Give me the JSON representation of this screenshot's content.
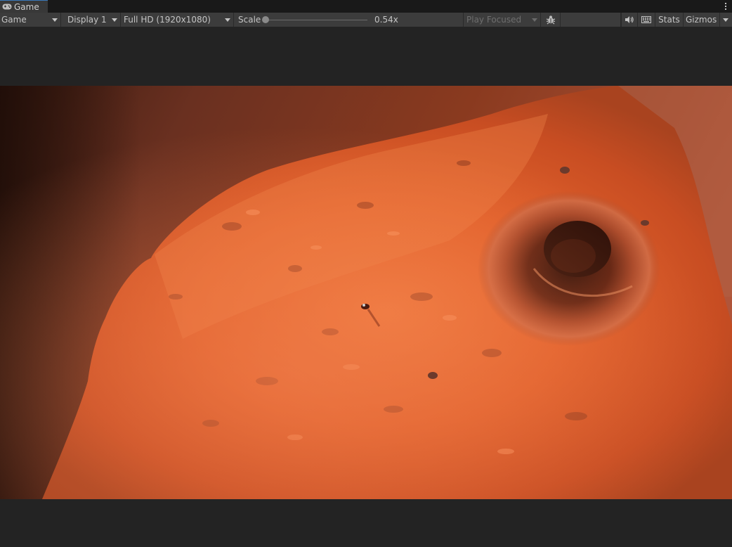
{
  "window": {
    "tab_title": "Game",
    "tab_icon": "gamepad-icon",
    "menu_icon": "kebab-menu-icon"
  },
  "toolbar": {
    "view_mode": "Game",
    "display": "Display 1",
    "resolution": "Full HD (1920x1080)",
    "scale_label": "Scale",
    "scale_value": "0.54x",
    "play_mode": "Play Focused",
    "bug_icon": "bug-icon",
    "mute_icon": "speaker-icon",
    "keyboard_icon": "keyboard-icon",
    "stats_label": "Stats",
    "gizmos_label": "Gizmos"
  },
  "colors": {
    "editor_bg": "#232323",
    "toolbar_bg": "#3c3c3c",
    "tab_accent": "#3a79bb",
    "terrain_dark": "#5a2a1a",
    "terrain_bright": "#e0642e"
  }
}
